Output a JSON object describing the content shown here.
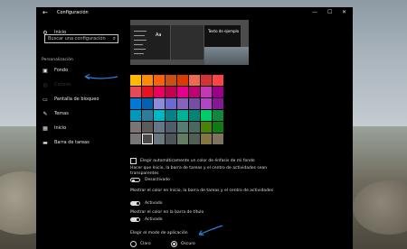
{
  "window": {
    "title": "Configuración",
    "back_icon": "←",
    "minimize_icon": "—",
    "maximize_icon": "☐",
    "close_icon": "✕"
  },
  "sidebar": {
    "home": "Inicio",
    "search_placeholder": "Buscar una configuración",
    "section": "Personalización",
    "items": [
      {
        "label": "Fondo",
        "icon": "picture-icon"
      },
      {
        "label": "Colores",
        "icon": "palette-icon",
        "active": true
      },
      {
        "label": "Pantalla de bloqueo",
        "icon": "lock-screen-icon"
      },
      {
        "label": "Temas",
        "icon": "brush-icon"
      },
      {
        "label": "Inicio",
        "icon": "start-icon"
      },
      {
        "label": "Barra de tareas",
        "icon": "taskbar-icon"
      }
    ]
  },
  "preview": {
    "aa": "Aa",
    "sample": "Texto de ejemplo"
  },
  "swatches": [
    "#ffb900",
    "#ff8c00",
    "#f7630c",
    "#ca5010",
    "#da3b01",
    "#ef6950",
    "#d13438",
    "#ff4343",
    "#e74856",
    "#e81123",
    "#ea005e",
    "#c30052",
    "#e3008c",
    "#bf0077",
    "#c239b3",
    "#9a0089",
    "#0078d7",
    "#0063b1",
    "#8e8cd8",
    "#6b69d6",
    "#8764b8",
    "#744da9",
    "#b146c2",
    "#881798",
    "#0099bc",
    "#2d7d9a",
    "#00b7c3",
    "#038387",
    "#00b294",
    "#018574",
    "#00cc6a",
    "#10893e",
    "#7a7574",
    "#5d5a58",
    "#68768a",
    "#515c6b",
    "#567c73",
    "#486860",
    "#498205",
    "#107c10",
    "#767676",
    "#4c4a48",
    "#69797e",
    "#4a5459",
    "#647c64",
    "#525e54",
    "#847545",
    "#7e735f"
  ],
  "selected_swatch": 41,
  "auto_accent": "Elegir automáticamente un color de énfasis de mi fondo",
  "transparency": {
    "text": "Hacer que Inicio, la barra de tareas y el centro de actividades sean transparentes",
    "state": "Desactivado"
  },
  "start_color": {
    "text": "Mostrar el color en Inicio, la barra de tareas y el centro de actividades",
    "state": "Activado"
  },
  "titlebar_color": {
    "text": "Mostrar el color en la barra de título",
    "state": "Activado"
  },
  "app_mode": {
    "heading": "Elegir el modo de aplicación",
    "light": "Claro",
    "dark": "Oscuro",
    "selected": "dark"
  },
  "colors": {
    "accent_arrow": "#2d7fd6"
  }
}
